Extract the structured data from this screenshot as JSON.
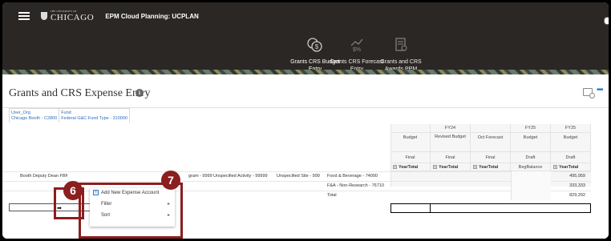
{
  "topbar": {
    "logo_small": "THE UNIVERSITY OF",
    "logo_big": "CHICAGO",
    "app_title": "EPM Cloud Planning: UCPLAN"
  },
  "nav": {
    "items": [
      {
        "label": "Grants CRS Budget Entry",
        "icon": "budget-money-icon"
      },
      {
        "label": "Grants CRS Forecast Entry",
        "icon": "forecast-percent-icon"
      },
      {
        "label": "Grants and CRS Awards PPM",
        "icon": "awards-document-icon"
      }
    ]
  },
  "page": {
    "title": "Grants and CRS Expense Entry",
    "info": "i"
  },
  "pov": {
    "user_org_label": "User_Org",
    "user_org_value": "Chicago Booth - C2800",
    "fund_label": "Fund",
    "fund_value": "Federal G&C Fund Type - 310000"
  },
  "grid": {
    "columns": [
      {
        "period": "",
        "scenario": "Budget",
        "version": "Final",
        "year": "YearTotal"
      },
      {
        "period": "FY24",
        "scenario": "Revised Budget",
        "version": "Final",
        "year": "YearTotal"
      },
      {
        "period": "",
        "scenario": "Oct Forecast",
        "version": "Final",
        "year": "YearTotal"
      },
      {
        "period": "FY25",
        "scenario": "Budget",
        "version": "Draft",
        "year": "BegBalance"
      },
      {
        "period": "FY25",
        "scenario": "Budget",
        "version": "Draft",
        "year": "YearTotal"
      }
    ],
    "row_labels": {
      "dept": "Booth Deputy Dean FBF",
      "program": "gram - 9999",
      "activity": "Unspecified Activity - 99999",
      "site": "Unspecified Site - 999",
      "account1": "Food & Beverage - 74000",
      "account2": "F&A - Non-Research - 76710",
      "total": "Total"
    },
    "values": {
      "row1": "495,959",
      "row2": "333,333",
      "total": "829,292"
    }
  },
  "context_menu": {
    "items": [
      "Add New Expense Account",
      "Filter",
      "Sort"
    ]
  },
  "callouts": {
    "badge6": "6",
    "badge7": "7"
  },
  "colors": {
    "topbar": "#2b2725",
    "callout": "#8b1e1e",
    "link": "#2a6ebb"
  }
}
